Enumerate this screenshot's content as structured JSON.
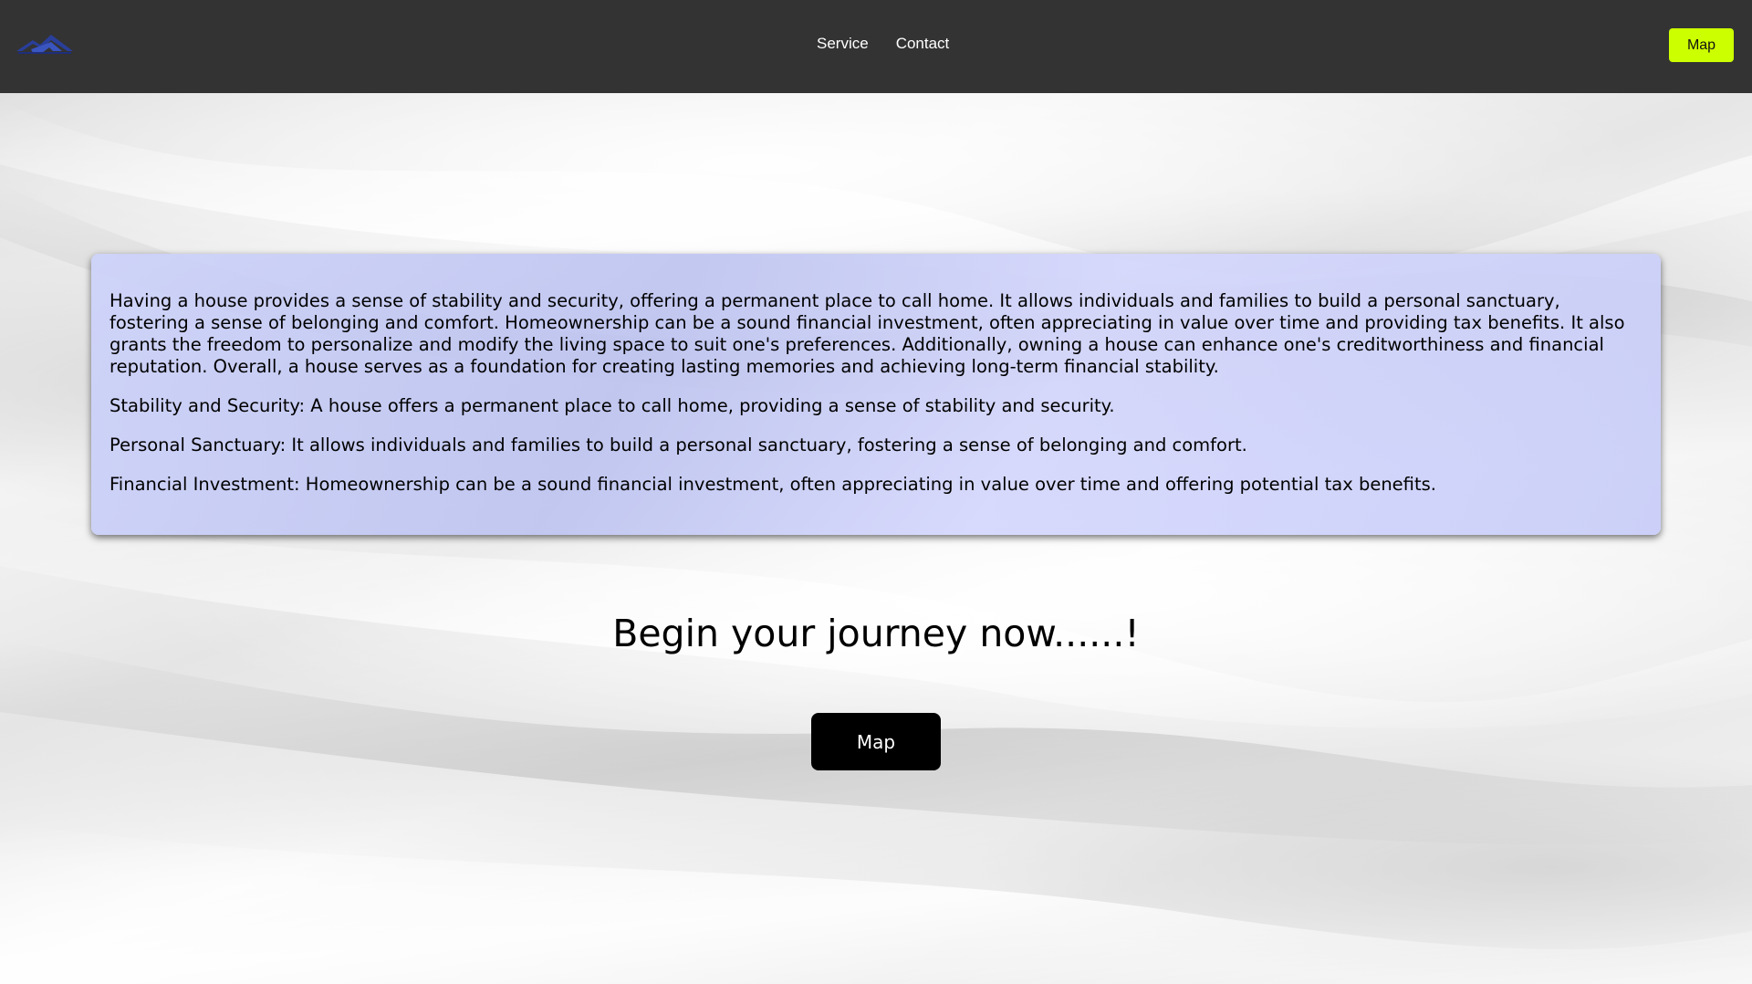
{
  "header": {
    "logo_icon": "house-logo-icon",
    "nav": [
      {
        "label": "Service"
      },
      {
        "label": "Contact"
      }
    ],
    "map_button_label": "Map",
    "colors": {
      "background": "#333333",
      "map_button": "#ccff00",
      "logo": "#2a3f9a"
    }
  },
  "info_card": {
    "paragraphs": [
      "Having a house provides a sense of stability and security, offering a permanent place to call home. It allows individuals and families to build a personal sanctuary, fostering a sense of belonging and comfort. Homeownership can be a sound financial investment, often appreciating in value over time and providing tax benefits. It also grants the freedom to personalize and modify the living space to suit one's preferences. Additionally, owning a house can enhance one's creditworthiness and financial reputation. Overall, a house serves as a foundation for creating lasting memories and achieving long-term financial stability.",
      "Stability and Security: A house offers a permanent place to call home, providing a sense of stability and security.",
      "Personal Sanctuary: It allows individuals and families to build a personal sanctuary, fostering a sense of belonging and comfort.",
      "Financial Investment: Homeownership can be a sound financial investment, often appreciating in value over time and offering potential tax benefits."
    ],
    "background_color": "#ccd0f8"
  },
  "cta": {
    "title": "Begin your journey now......!",
    "button_label": "Map",
    "button_color": "#000000"
  }
}
